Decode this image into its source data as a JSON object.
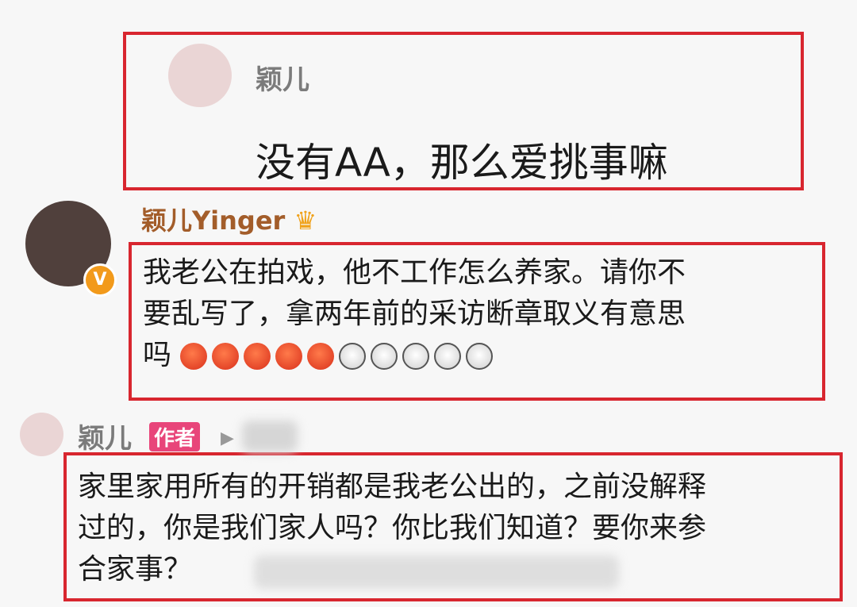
{
  "comments": [
    {
      "author": "颖儿",
      "text": "没有AA，那么爱挑事嘛"
    },
    {
      "author": "颖儿Yinger",
      "lines": [
        "我老公在拍戏，他不工作怎么养家。请你不",
        "要乱写了，拿两年前的采访断章取义有意思",
        "吗"
      ]
    },
    {
      "author": "颖儿",
      "badge": "作者",
      "lines": [
        "家里家用所有的开销都是我老公出的，之前没解释",
        "过的，你是我们家人吗？你比我们知道？要你来参",
        "合家事？"
      ]
    }
  ],
  "emoji": {
    "angry_count": 5,
    "husky_count": 5
  },
  "colors": {
    "highlight": "#d8262f",
    "badge": "#e8457a"
  }
}
